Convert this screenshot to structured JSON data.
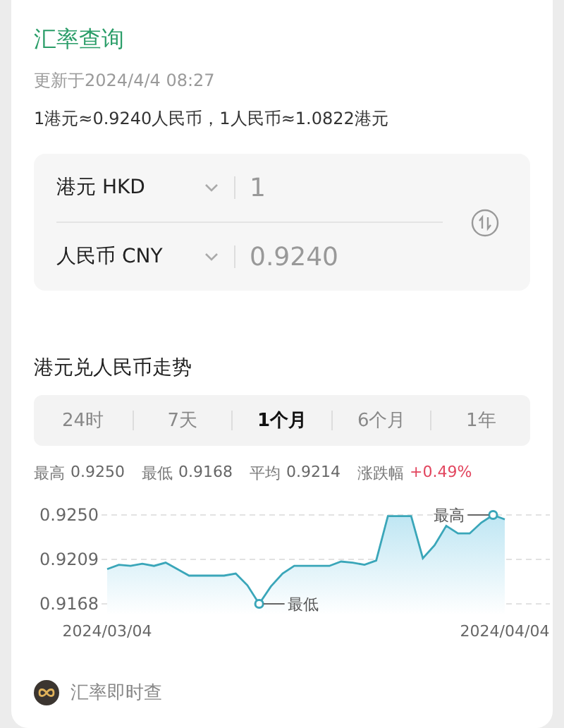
{
  "header": {
    "title": "汇率查询",
    "updated": "更新于2024/4/4 08:27",
    "rates": "1港元≈0.9240人民币，1人民币≈1.0822港元"
  },
  "converter": {
    "rows": [
      {
        "currency": "港元 HKD",
        "amount": "1"
      },
      {
        "currency": "人民币 CNY",
        "amount": "0.9240"
      }
    ]
  },
  "trend": {
    "title": "港元兑人民币走势",
    "tabs": [
      {
        "label": "24时",
        "selected": false
      },
      {
        "label": "7天",
        "selected": false
      },
      {
        "label": "1个月",
        "selected": true
      },
      {
        "label": "6个月",
        "selected": false
      },
      {
        "label": "1年",
        "selected": false
      }
    ],
    "stats": [
      {
        "kind": "plain",
        "label": "最高",
        "value": "0.9250"
      },
      {
        "kind": "plain",
        "label": "最低",
        "value": "0.9168"
      },
      {
        "kind": "plain",
        "label": "平均",
        "value": "0.9214"
      },
      {
        "kind": "change",
        "label": "涨跌幅",
        "value": "+0.49%"
      }
    ],
    "chart_data": {
      "type": "area",
      "categories": [
        "2024/03/04",
        null,
        null,
        null,
        null,
        null,
        null,
        null,
        null,
        null,
        null,
        null,
        null,
        null,
        null,
        null,
        null,
        null,
        null,
        null,
        null,
        null,
        null,
        null,
        null,
        null,
        null,
        null,
        null,
        null,
        null,
        null,
        null,
        null,
        "2024/04/04"
      ],
      "series": [
        {
          "color": "#3aa6b9",
          "values": [
            0.92,
            0.9204,
            0.9203,
            0.9205,
            0.9203,
            0.9206,
            0.92,
            0.9194,
            0.9194,
            0.9194,
            0.9194,
            0.9196,
            0.9185,
            0.9168,
            0.9184,
            0.9196,
            0.9203,
            0.9203,
            0.9203,
            0.9203,
            0.9207,
            0.9206,
            0.9204,
            0.9208,
            0.9249,
            0.9249,
            0.9249,
            0.921,
            0.9222,
            0.924,
            0.9233,
            0.9233,
            0.9243,
            0.925,
            0.9246
          ]
        }
      ],
      "ylim": [
        0.9168,
        0.925
      ],
      "yticks": [
        {
          "value": 0.9168,
          "label": "0.9168"
        },
        {
          "value": 0.9209,
          "label": "0.9209"
        },
        {
          "value": 0.925,
          "label": "0.9250"
        }
      ],
      "annotations": [
        "最高",
        "最低"
      ]
    }
  },
  "footer": {
    "label": "汇率即时查"
  }
}
